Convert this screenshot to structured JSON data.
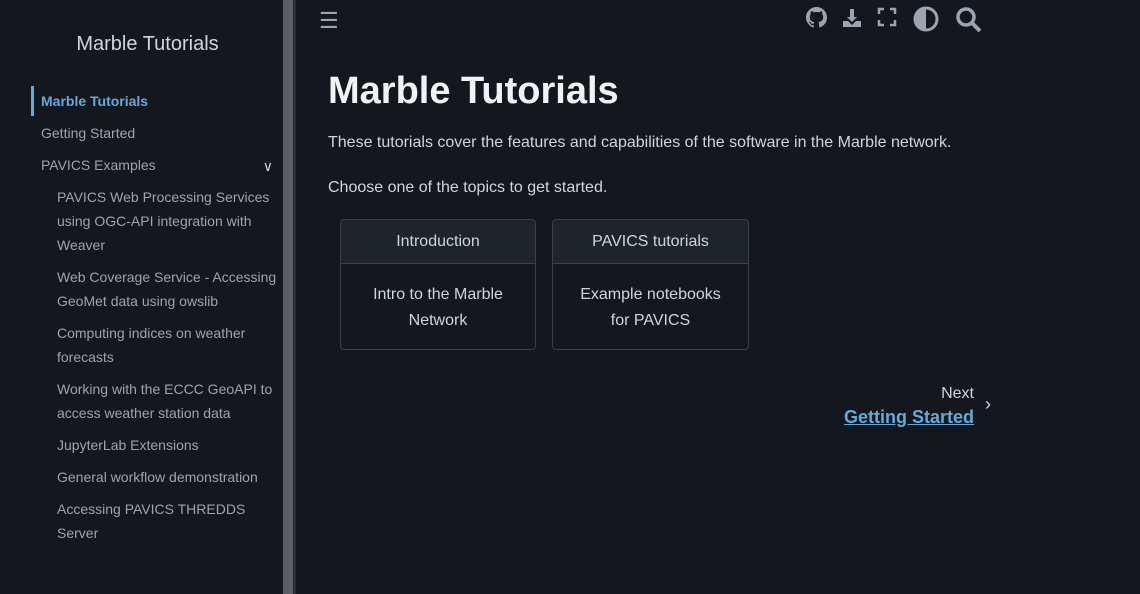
{
  "sidebar": {
    "title": "Marble Tutorials",
    "items": [
      {
        "label": "Marble Tutorials"
      },
      {
        "label": "Getting Started"
      },
      {
        "label": "PAVICS Examples"
      }
    ],
    "sub": [
      {
        "label": "PAVICS Web Processing Services using OGC-API integration with Weaver"
      },
      {
        "label": "Web Coverage Service - Accessing GeoMet data using owslib"
      },
      {
        "label": "Computing indices on weather forecasts"
      },
      {
        "label": "Working with the ECCC GeoAPI to access weather station data"
      },
      {
        "label": "JupyterLab Extensions"
      },
      {
        "label": "General workflow demonstration"
      },
      {
        "label": "Accessing PAVICS THREDDS Server"
      }
    ]
  },
  "main": {
    "title": "Marble Tutorials",
    "intro": "These tutorials cover the features and capabilities of the software in the Marble network.",
    "choose": "Choose one of the topics to get started.",
    "cards": [
      {
        "header": "Introduction",
        "body": "Intro to the Marble Network"
      },
      {
        "header": "PAVICS tutorials",
        "body": "Example notebooks for PAVICS"
      }
    ],
    "next_label": "Next",
    "next_link": "Getting Started"
  }
}
